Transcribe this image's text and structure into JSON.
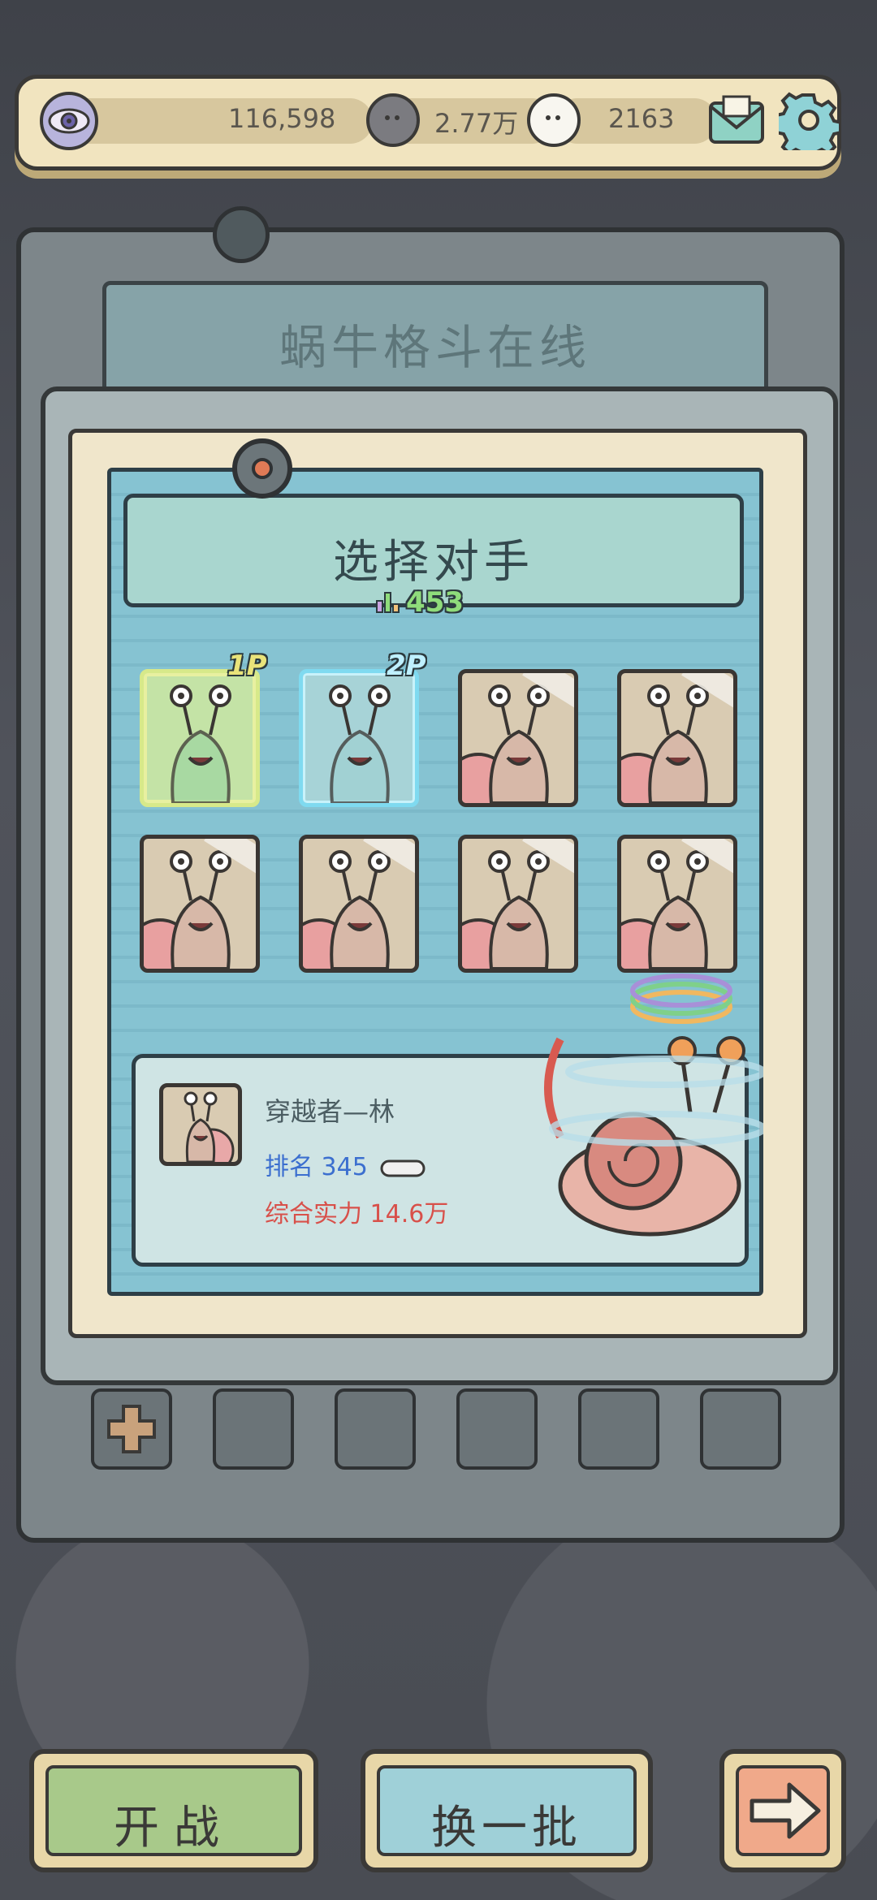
{
  "resources": {
    "eye_value": "116,598",
    "dark_bubble_value": "2.77万",
    "light_bubble_value": "2163"
  },
  "icons": {
    "eye": "eye-icon",
    "dark_bubble": "dark-speech-bubble-icon",
    "light_bubble": "light-speech-bubble-icon",
    "mail": "mail-icon",
    "settings": "gear-icon"
  },
  "background_panel": {
    "title": "蜗牛格斗在线"
  },
  "select_panel": {
    "title": "选择对手",
    "power_value": "453"
  },
  "cards": [
    {
      "tag": "1P",
      "state": "selected-1p"
    },
    {
      "tag": "2P",
      "state": "selected-2p"
    },
    {
      "tag": "",
      "state": "opponent"
    },
    {
      "tag": "",
      "state": "opponent"
    },
    {
      "tag": "",
      "state": "opponent"
    },
    {
      "tag": "",
      "state": "opponent"
    },
    {
      "tag": "",
      "state": "opponent"
    },
    {
      "tag": "",
      "state": "opponent"
    }
  ],
  "opponent_info": {
    "name": "穿越者—林",
    "rank_label": "排名",
    "rank_value": "345",
    "power_label": "综合实力",
    "power_value": "14.6万"
  },
  "buttons": {
    "fight": "开战",
    "refresh": "换一批",
    "next": "arrow-right-icon"
  },
  "colors": {
    "fight_button": "#a8c98a",
    "refresh_button": "#9fd0d8",
    "next_button": "#f0a98a",
    "rank_text": "#3c6fcf",
    "power_text": "#d8504a",
    "power_number": "#8fdc7b"
  }
}
